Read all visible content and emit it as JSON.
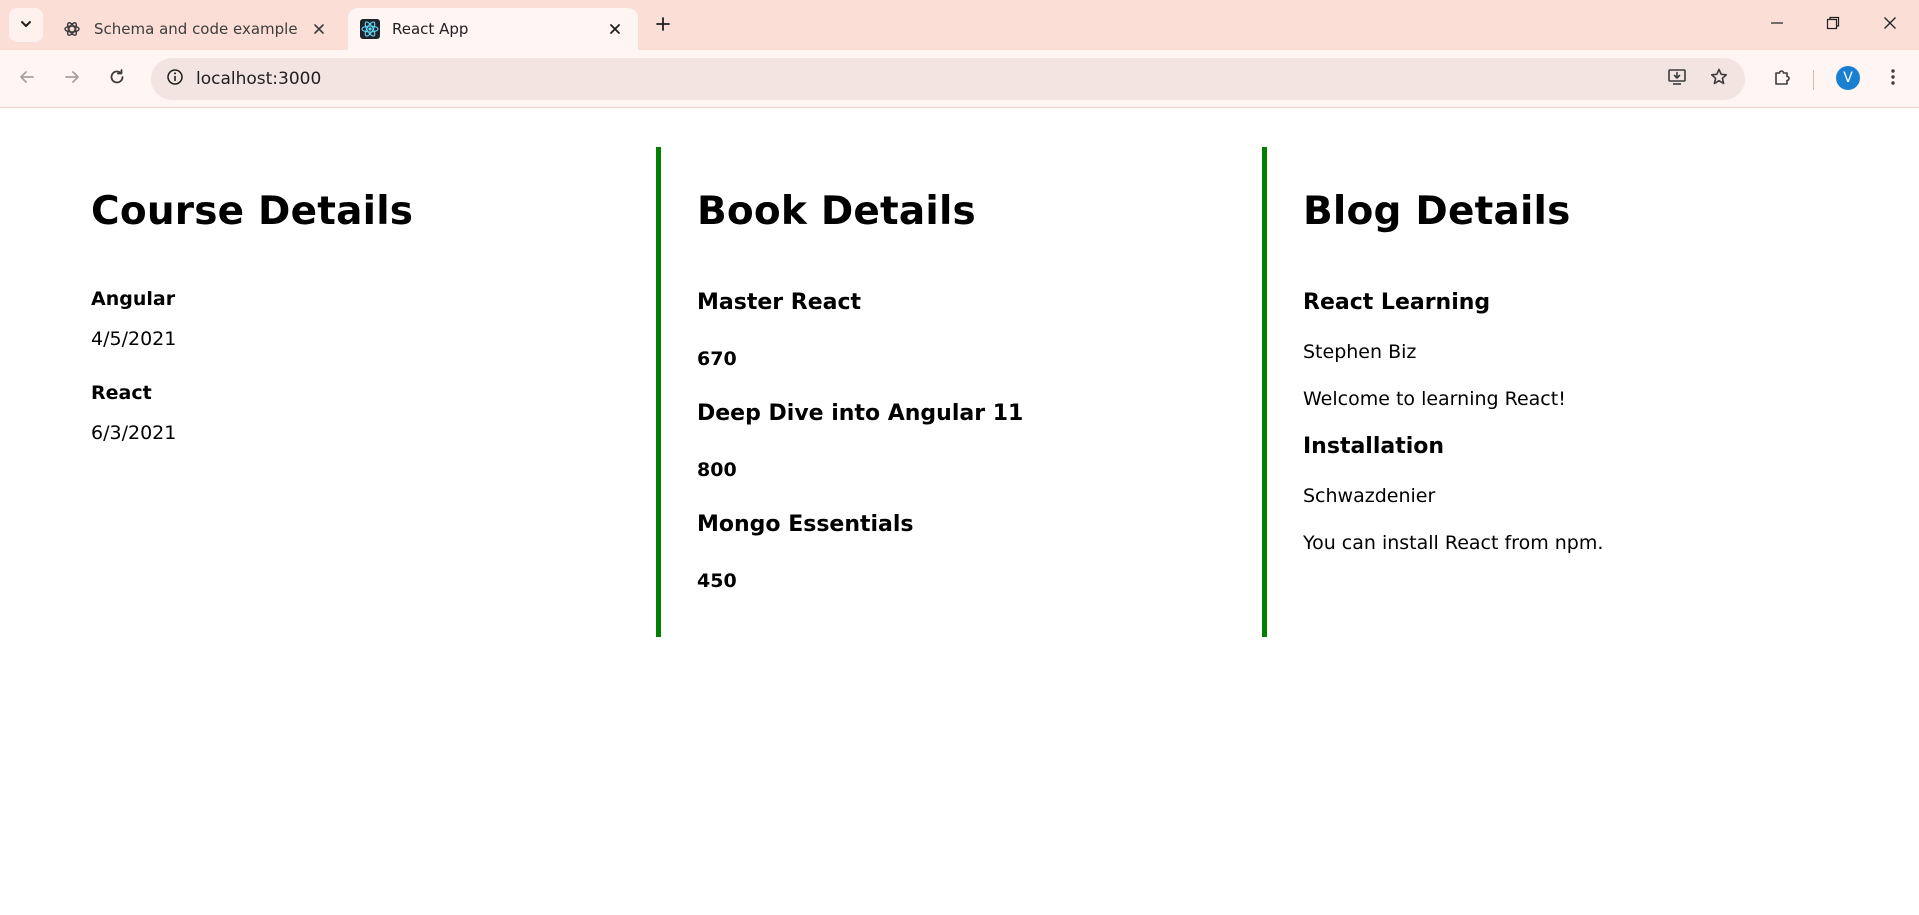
{
  "browser": {
    "tabs": [
      {
        "title": "Schema and code example",
        "icon": "openai-icon",
        "active": false
      },
      {
        "title": "React App",
        "icon": "react-icon",
        "active": true
      }
    ],
    "url": "localhost:3000",
    "avatar_letter": "V",
    "accent_color": "#1a7fd0"
  },
  "courses": {
    "title": "Course Details",
    "items": [
      {
        "name": "Angular",
        "date": "4/5/2021"
      },
      {
        "name": "React",
        "date": "6/3/2021"
      }
    ]
  },
  "books": {
    "title": "Book Details",
    "items": [
      {
        "name": "Master React",
        "price": "670"
      },
      {
        "name": "Deep Dive into Angular 11",
        "price": "800"
      },
      {
        "name": "Mongo Essentials",
        "price": "450"
      }
    ]
  },
  "blogs": {
    "title": "Blog Details",
    "items": [
      {
        "title": "React Learning",
        "author": "Stephen Biz",
        "content": "Welcome to learning React!"
      },
      {
        "title": "Installation",
        "author": "Schwazdenier",
        "content": "You can install React from npm."
      }
    ]
  },
  "divider_color": "#008000"
}
